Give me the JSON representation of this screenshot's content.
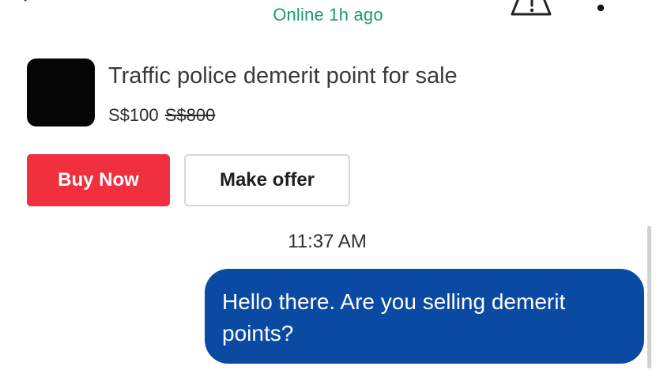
{
  "header": {
    "status": "Online 1h ago",
    "back_icon": "arrow-left-icon",
    "report_icon": "warning-triangle-icon",
    "more_icon": "more-dots-icon"
  },
  "listing": {
    "title": "Traffic police demerit point for sale",
    "price": "S$100",
    "original_price": "S$800"
  },
  "actions": {
    "buy_now_label": "Buy Now",
    "make_offer_label": "Make offer"
  },
  "chat": {
    "timestamp": "11:37 AM",
    "messages": [
      {
        "sender": "me",
        "text": "Hello there. Are you selling demerit points?"
      }
    ]
  },
  "colors": {
    "status_green": "#1a9b6c",
    "buy_red": "#f0303f",
    "bubble_blue": "#0b4aa3"
  }
}
